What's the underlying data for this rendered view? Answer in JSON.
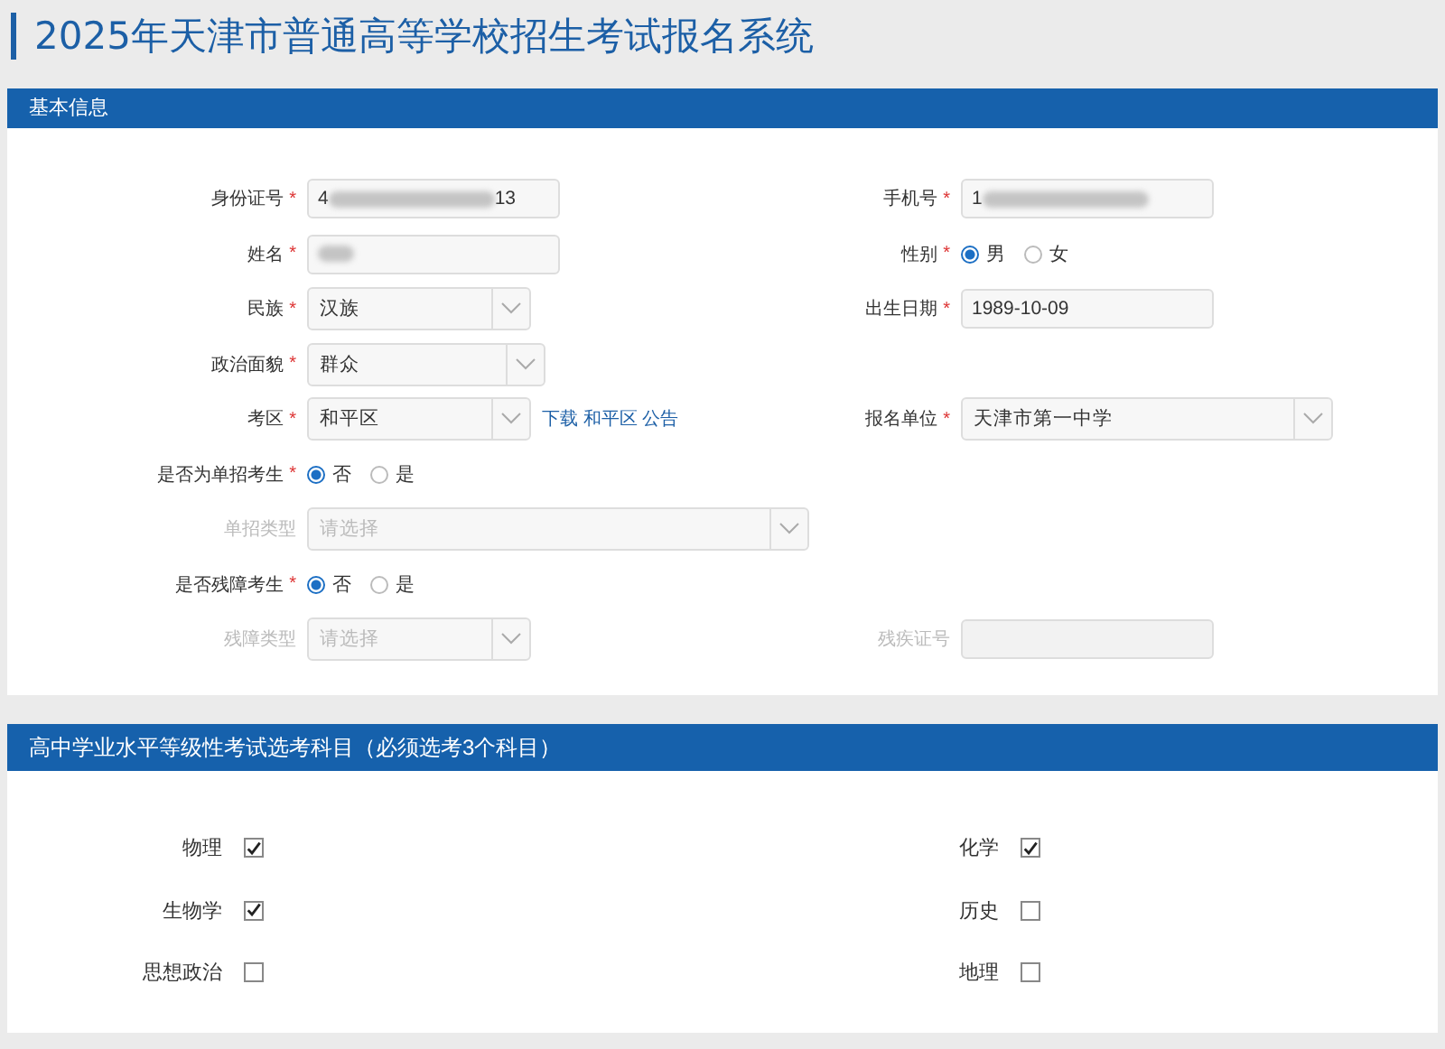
{
  "page_title": "2025年天津市普通高等学校招生考试报名系统",
  "basic_info": {
    "title": "基本信息",
    "rows": [
      {
        "left": {
          "kind": "masked",
          "label": "身份证号",
          "required_mark": "*",
          "value_start": "4",
          "value_end": "13",
          "disabled": false
        },
        "right": {
          "kind": "masked",
          "label": "手机号",
          "required_mark": "*",
          "value_start": "1",
          "disabled": false
        }
      },
      {
        "left": {
          "kind": "masked",
          "label": "姓名",
          "required_mark": "*",
          "disabled": false
        },
        "right": {
          "kind": "radio",
          "label": "性别",
          "required_mark": "*",
          "disabled": false,
          "options": [
            {
              "label": "男",
              "selected": true
            },
            {
              "label": "女",
              "selected": false
            }
          ]
        }
      },
      {
        "left": {
          "kind": "select",
          "label": "民族",
          "required_mark": "*",
          "value": "汉族",
          "disabled": false
        },
        "right": {
          "kind": "input",
          "label": "出生日期",
          "required_mark": "*",
          "value": "1989-10-09",
          "disabled": false
        }
      },
      {
        "left": {
          "kind": "select",
          "label": "政治面貌",
          "required_mark": "*",
          "value": "群众",
          "disabled": false
        }
      },
      {
        "left": {
          "kind": "select",
          "label": "考区",
          "required_mark": "*",
          "value": "和平区",
          "link": "下载 和平区 公告",
          "disabled": false
        },
        "right": {
          "kind": "select",
          "label": "报名单位",
          "required_mark": "*",
          "value": "天津市第一中学",
          "disabled": false
        }
      },
      {
        "left": {
          "kind": "radio",
          "label": "是否为单招考生",
          "required_mark": "*",
          "disabled": false,
          "options": [
            {
              "label": "否",
              "selected": true
            },
            {
              "label": "是",
              "selected": false
            }
          ]
        }
      },
      {
        "left": {
          "kind": "select",
          "label": "单招类型",
          "placeholder": "请选择",
          "disabled": true
        }
      },
      {
        "left": {
          "kind": "radio",
          "label": "是否残障考生",
          "required_mark": "*",
          "disabled": false,
          "options": [
            {
              "label": "否",
              "selected": true
            },
            {
              "label": "是",
              "selected": false
            }
          ]
        }
      },
      {
        "left": {
          "kind": "select",
          "label": "残障类型",
          "placeholder": "请选择",
          "disabled": true
        },
        "right": {
          "kind": "input",
          "label": "残疾证号",
          "disabled": true
        }
      }
    ]
  },
  "subjects": {
    "title": "高中学业水平等级性考试选考科目（必须选考3个科目）",
    "items": [
      {
        "label": "物理",
        "checked": true
      },
      {
        "label": "化学",
        "checked": true
      },
      {
        "label": "生物学",
        "checked": true
      },
      {
        "label": "历史",
        "checked": false
      },
      {
        "label": "思想政治",
        "checked": false
      },
      {
        "label": "地理",
        "checked": false
      }
    ]
  }
}
